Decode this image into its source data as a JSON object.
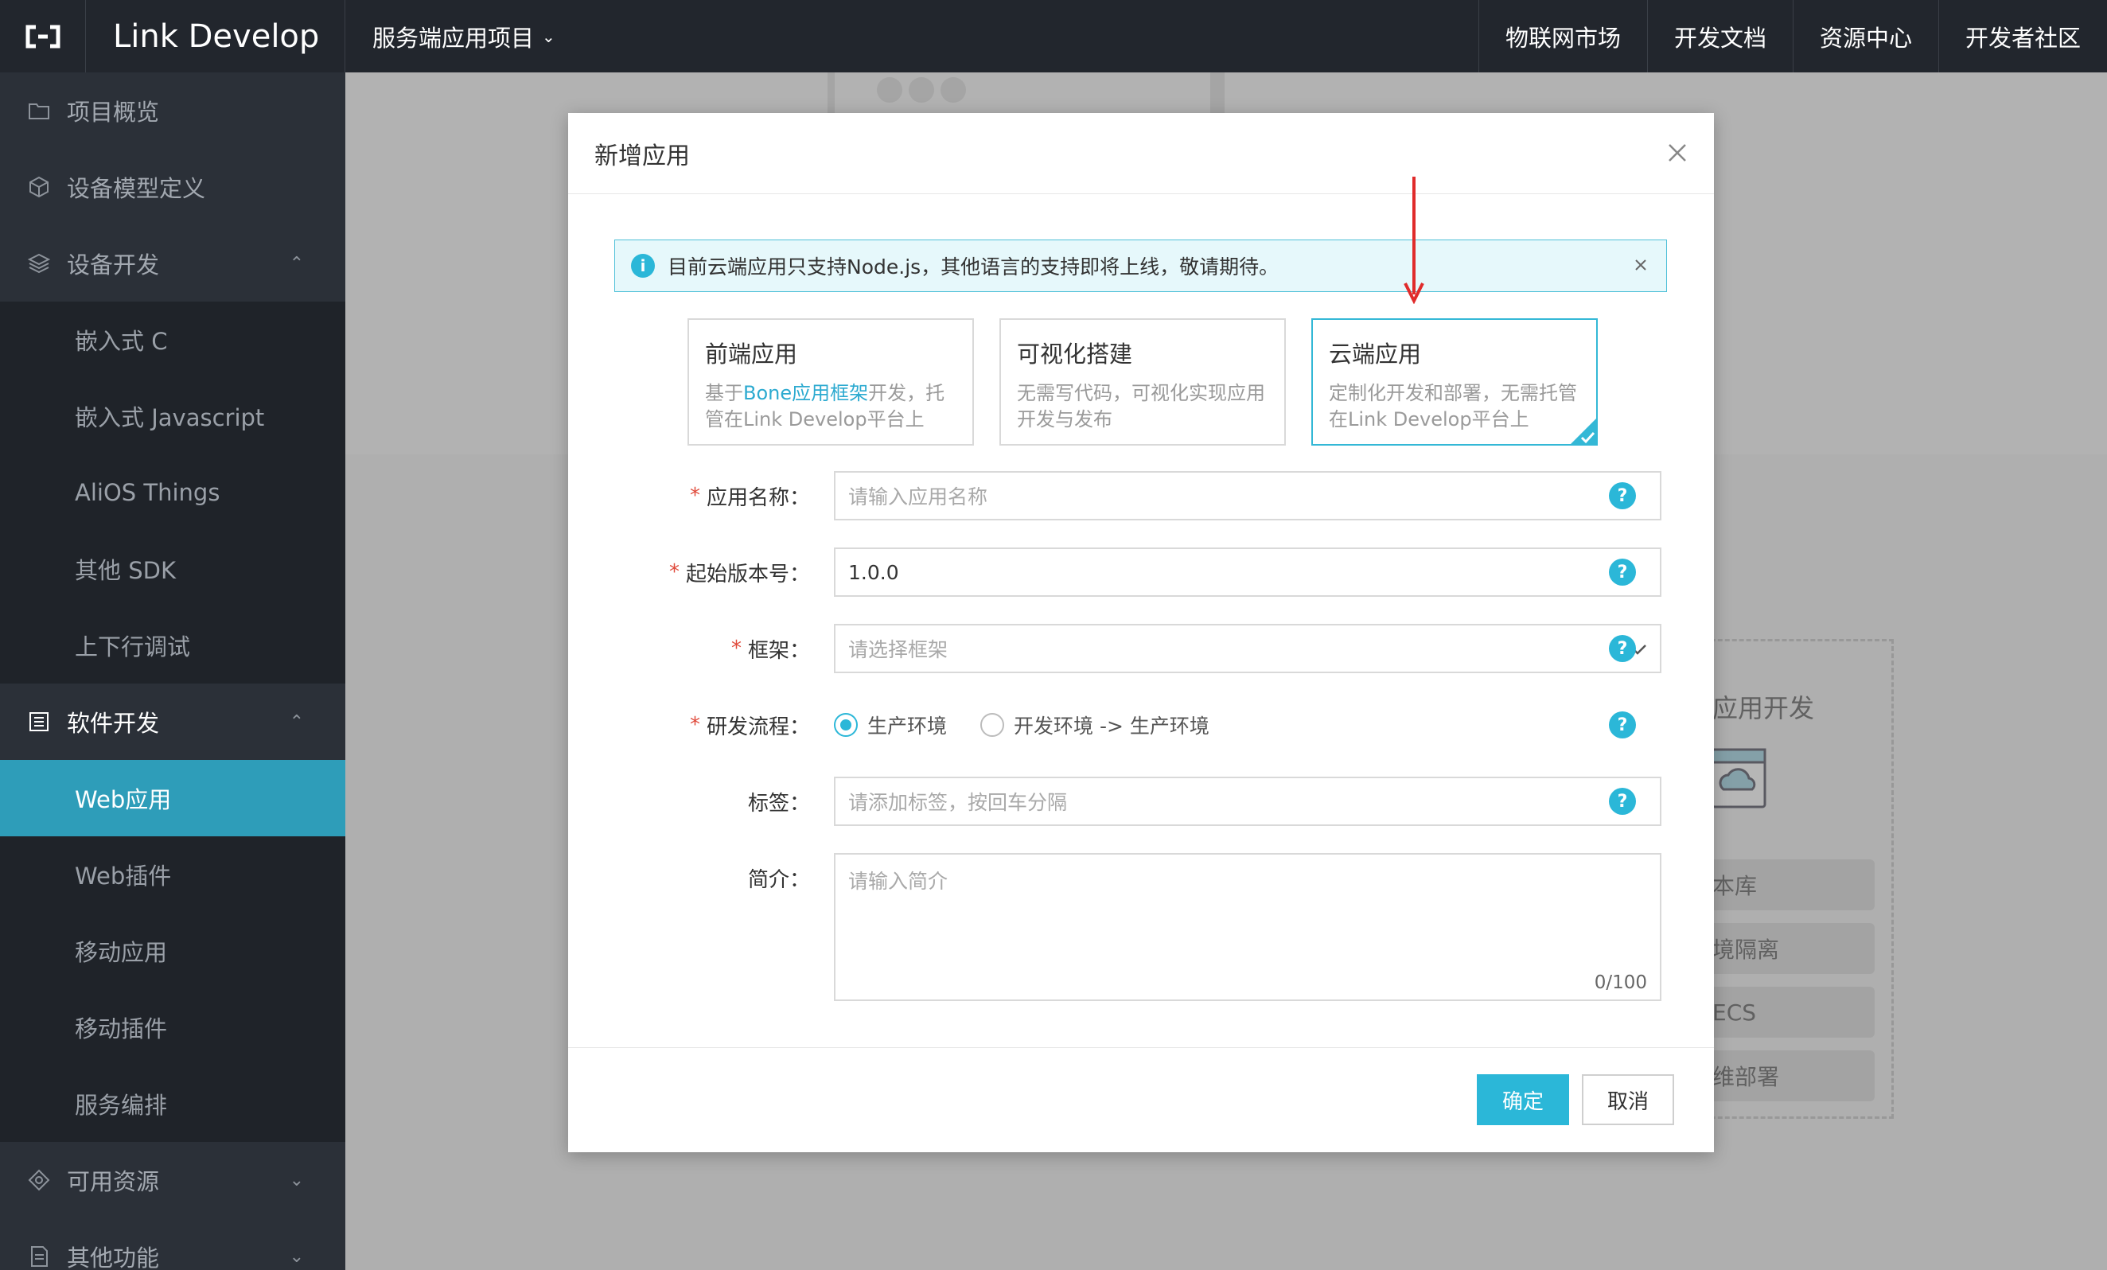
{
  "topbar": {
    "brand": "Link Develop",
    "project": "服务端应用项目",
    "nav": [
      "物联网市场",
      "开发文档",
      "资源中心",
      "开发者社区"
    ]
  },
  "sidebar": {
    "overview": "项目概览",
    "model": "设备模型定义",
    "device_dev": "设备开发",
    "device_sub": [
      "嵌入式 C",
      "嵌入式 Javascript",
      "AliOS Things",
      "其他 SDK",
      "上下行调试"
    ],
    "software_dev": "软件开发",
    "software_sub": [
      "Web应用",
      "Web插件",
      "移动应用",
      "移动插件",
      "服务编排"
    ],
    "resources": "可用资源",
    "other": "其他功能"
  },
  "background": {
    "title": "应用开发",
    "chips": [
      "本库",
      "境隔离",
      "ECS",
      "维部署"
    ]
  },
  "modal": {
    "title": "新增应用",
    "alert": "目前云端应用只支持Node.js，其他语言的支持即将上线，敬请期待。",
    "types": [
      {
        "title": "前端应用",
        "desc_prefix": "基于",
        "desc_link": "Bone应用框架",
        "desc_suffix": "开发，托管在Link Develop平台上"
      },
      {
        "title": "可视化搭建",
        "desc": "无需写代码，可视化实现应用开发与发布"
      },
      {
        "title": "云端应用",
        "desc": "定制化开发和部署，无需托管在Link Develop平台上"
      }
    ],
    "form": {
      "name_label": "应用名称：",
      "name_placeholder": "请输入应用名称",
      "version_label": "起始版本号：",
      "version_value": "1.0.0",
      "framework_label": "框架：",
      "framework_placeholder": "请选择框架",
      "flow_label": "研发流程：",
      "flow_options": [
        "生产环境",
        "开发环境 -> 生产环境"
      ],
      "tags_label": "标签：",
      "tags_placeholder": "请添加标签，按回车分隔",
      "intro_label": "简介：",
      "intro_placeholder": "请输入简介",
      "intro_counter": "0/100"
    },
    "ok": "确定",
    "cancel": "取消"
  },
  "colors": {
    "accent": "#2bb7d8",
    "active_nav": "#2e9db9",
    "required": "#e04b3c",
    "arrow": "#e02b2b"
  }
}
